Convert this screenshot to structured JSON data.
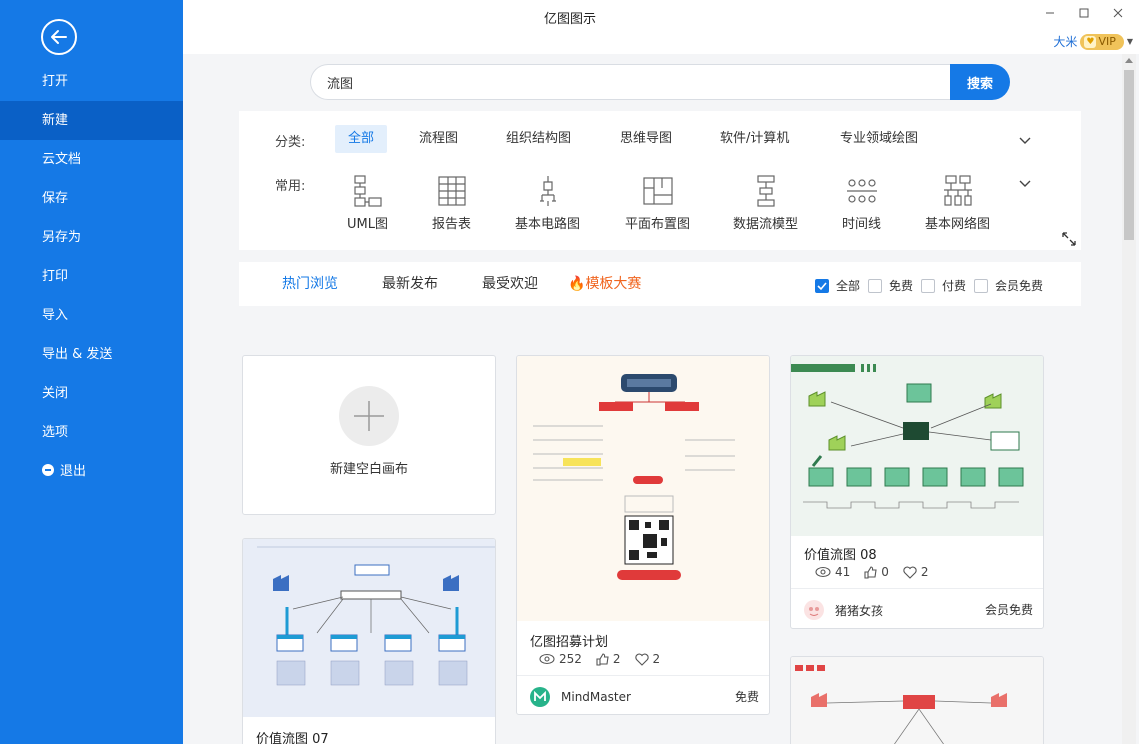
{
  "app": {
    "title": "亿图图示"
  },
  "user": {
    "name": "大米",
    "vip_label": "VIP"
  },
  "sidebar": {
    "items": [
      {
        "label": "打开"
      },
      {
        "label": "新建"
      },
      {
        "label": "云文档"
      },
      {
        "label": "保存"
      },
      {
        "label": "另存为"
      },
      {
        "label": "打印"
      },
      {
        "label": "导入"
      },
      {
        "label": "导出 & 发送"
      },
      {
        "label": "关闭"
      },
      {
        "label": "选项"
      },
      {
        "label": "退出"
      }
    ],
    "active_index": 1
  },
  "search": {
    "value": "流图",
    "button": "搜索"
  },
  "categories": {
    "label": "分类:",
    "items": [
      "全部",
      "流程图",
      "组织结构图",
      "思维导图",
      "软件/计算机",
      "专业领域绘图"
    ]
  },
  "common": {
    "label": "常用:",
    "items": [
      {
        "label": "UML图",
        "icon": "uml-icon"
      },
      {
        "label": "报告表",
        "icon": "report-icon"
      },
      {
        "label": "基本电路图",
        "icon": "circuit-icon"
      },
      {
        "label": "平面布置图",
        "icon": "floorplan-icon"
      },
      {
        "label": "数据流模型",
        "icon": "dataflow-icon"
      },
      {
        "label": "时间线",
        "icon": "timeline-icon"
      },
      {
        "label": "基本网络图",
        "icon": "network-icon"
      }
    ]
  },
  "tabs": {
    "hot": "热门浏览",
    "new": "最新发布",
    "popular": "最受欢迎",
    "contest": "模板大赛"
  },
  "filters": {
    "all": "全部",
    "free": "免费",
    "paid": "付费",
    "member": "会员免费"
  },
  "new_blank": {
    "label": "新建空白画布"
  },
  "cards": [
    {
      "title": "亿图招募计划",
      "views": "252",
      "likes": "2",
      "favs": "2",
      "author": "MindMaster",
      "price": "免费"
    },
    {
      "title": "价值流图 08",
      "views": "41",
      "likes": "0",
      "favs": "2",
      "author": "猪猪女孩",
      "price": "会员免费"
    },
    {
      "title": "价值流图 07"
    }
  ],
  "colors": {
    "accent": "#1579e6",
    "sidebar": "#1579e6",
    "contest": "#f0641e"
  }
}
